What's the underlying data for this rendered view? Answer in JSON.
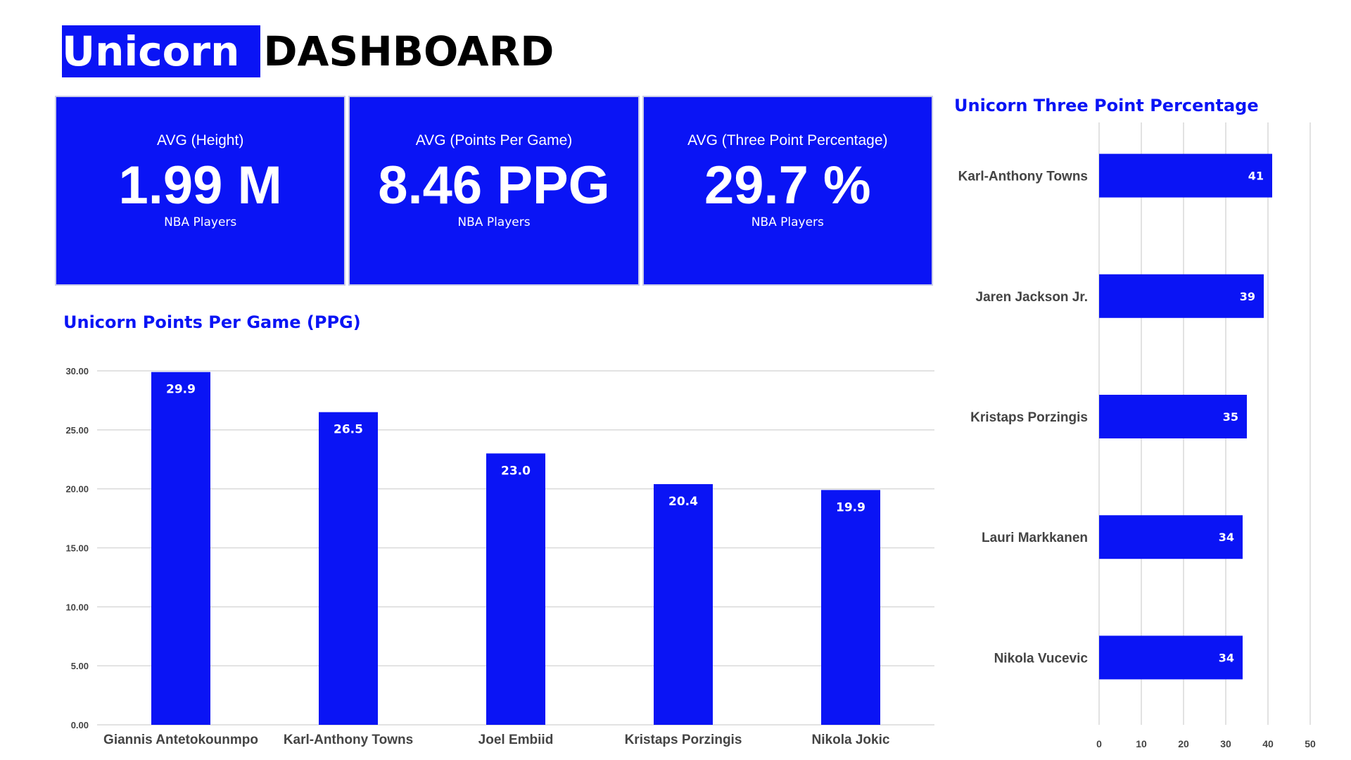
{
  "header": {
    "brand": "Unicorn",
    "title": "DASHBOARD"
  },
  "kpis": [
    {
      "label": "AVG (Height)",
      "value": "1.99 M",
      "sub": "NBA Players"
    },
    {
      "label": "AVG (Points Per Game)",
      "value": "8.46 PPG",
      "sub": "NBA Players"
    },
    {
      "label": "AVG (Three Point Percentage)",
      "value": "29.7 %",
      "sub": "NBA Players"
    }
  ],
  "colors": {
    "accent": "#0a14f5",
    "grid": "#d9d9d9",
    "text": "#444444"
  },
  "chart_data": [
    {
      "type": "bar",
      "title": "Unicorn Points Per Game (PPG)",
      "categories": [
        "Giannis Antetokounmpo",
        "Karl-Anthony Towns",
        "Joel Embiid",
        "Kristaps Porzingis",
        "Nikola Jokic"
      ],
      "values": [
        29.9,
        26.5,
        23.0,
        20.4,
        19.9
      ],
      "data_labels": [
        "29.9",
        "26.5",
        "23.0",
        "20.4",
        "19.9"
      ],
      "ylim": [
        0,
        30
      ],
      "yticks": [
        "0.00",
        "5.00",
        "10.00",
        "15.00",
        "20.00",
        "25.00",
        "30.00"
      ],
      "grid": true,
      "orientation": "vertical"
    },
    {
      "type": "bar",
      "title": "Unicorn Three Point Percentage",
      "categories": [
        "Karl-Anthony Towns",
        "Jaren Jackson Jr.",
        "Kristaps Porzingis",
        "Lauri Markkanen",
        "Nikola Vucevic"
      ],
      "values": [
        41,
        39,
        35,
        34,
        34
      ],
      "data_labels": [
        "41",
        "39",
        "35",
        "34",
        "34"
      ],
      "xlim": [
        0,
        50
      ],
      "xticks": [
        "0",
        "10",
        "20",
        "30",
        "40",
        "50"
      ],
      "grid": true,
      "orientation": "horizontal"
    }
  ]
}
